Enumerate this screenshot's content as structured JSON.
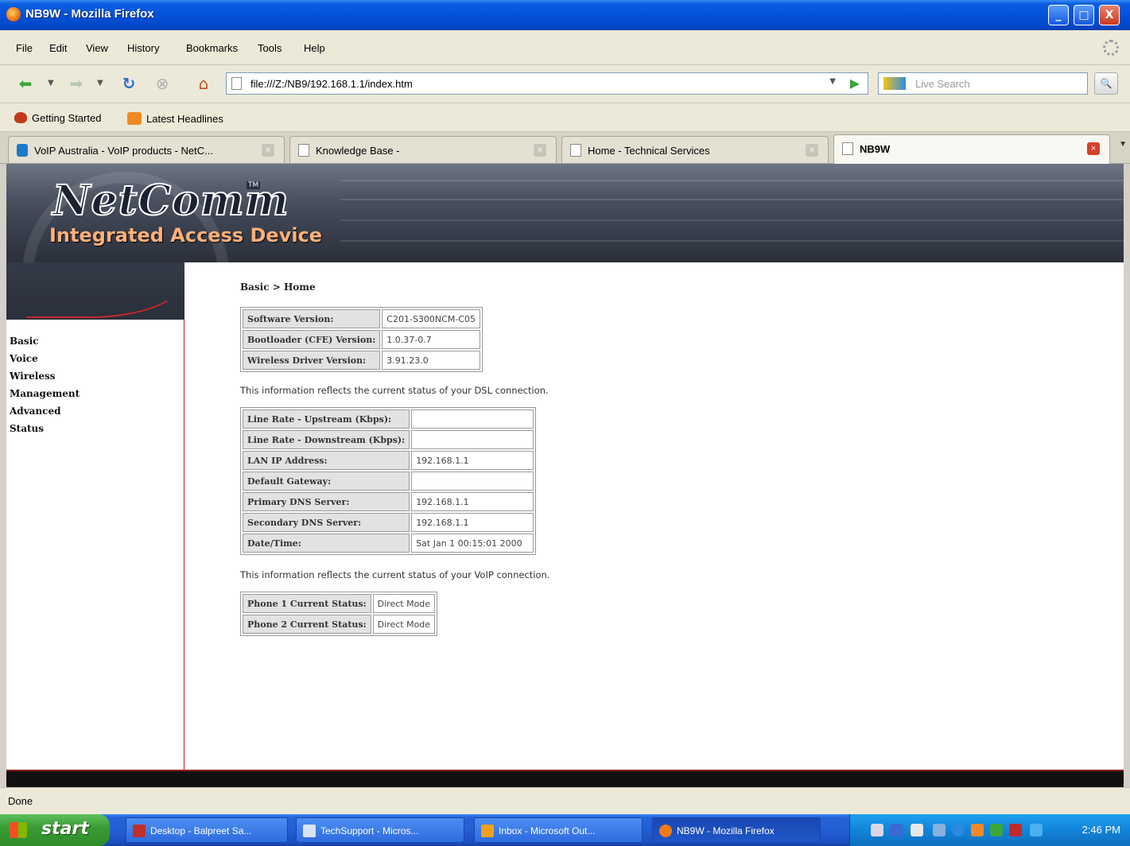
{
  "window": {
    "title": "NB9W - Mozilla Firefox",
    "controls": [
      "_",
      "□",
      "X"
    ]
  },
  "menu": [
    "File",
    "Edit",
    "View",
    "History",
    "Bookmarks",
    "Tools",
    "Help"
  ],
  "navbar": {
    "url": "file:///Z:/NB9/192.168.1.1/index.htm",
    "search_placeholder": "Live Search"
  },
  "bookmarks": [
    "Getting Started",
    "Latest Headlines"
  ],
  "tabs": [
    {
      "label": "VoIP Australia - VoIP products - NetC...",
      "active": false
    },
    {
      "label": "Knowledge Base -",
      "active": false
    },
    {
      "label": "Home - Technical Services",
      "active": false
    },
    {
      "label": "NB9W",
      "active": true
    }
  ],
  "banner": {
    "logo": "NetComm",
    "trademark": "TM",
    "subtitle": "Integrated Access Device"
  },
  "sidebar": {
    "items": [
      "Basic",
      "Voice",
      "Wireless",
      "Management",
      "Advanced",
      "Status"
    ]
  },
  "content": {
    "breadcrumb": "Basic > Home",
    "version_table": [
      {
        "label": "Software Version:",
        "value": "C201-S300NCM-C05"
      },
      {
        "label": "Bootloader (CFE) Version:",
        "value": "1.0.37-0.7"
      },
      {
        "label": "Wireless Driver Version:",
        "value": "3.91.23.0"
      }
    ],
    "dsl_text": "This information reflects the current status of your DSL connection.",
    "dsl_table": [
      {
        "label": "Line Rate - Upstream (Kbps):",
        "value": ""
      },
      {
        "label": "Line Rate - Downstream (Kbps):",
        "value": ""
      },
      {
        "label": "LAN IP Address:",
        "value": "192.168.1.1"
      },
      {
        "label": "Default Gateway:",
        "value": ""
      },
      {
        "label": "Primary DNS Server:",
        "value": "192.168.1.1"
      },
      {
        "label": "Secondary DNS Server:",
        "value": "192.168.1.1"
      },
      {
        "label": "Date/Time:",
        "value": "Sat Jan 1 00:15:01 2000"
      }
    ],
    "voip_text": "This information reflects the current status of your VoIP connection.",
    "voip_table": [
      {
        "label": "Phone 1 Current Status:",
        "value": "Direct Mode"
      },
      {
        "label": "Phone 2 Current Status:",
        "value": "Direct Mode"
      }
    ]
  },
  "status": "Done",
  "taskbar": {
    "start": "start",
    "tasks": [
      {
        "label": "Desktop - Balpreet Sa...",
        "icon_color": "#c0302a",
        "active": false
      },
      {
        "label": "TechSupport - Micros...",
        "icon_color": "#d8e4f4",
        "active": false
      },
      {
        "label": "Inbox - Microsoft Out...",
        "icon_color": "#f0a020",
        "active": false
      },
      {
        "label": "NB9W - Mozilla Firefox",
        "icon_color": "#f07a1a",
        "active": true
      }
    ],
    "clock": "2:46 PM"
  }
}
